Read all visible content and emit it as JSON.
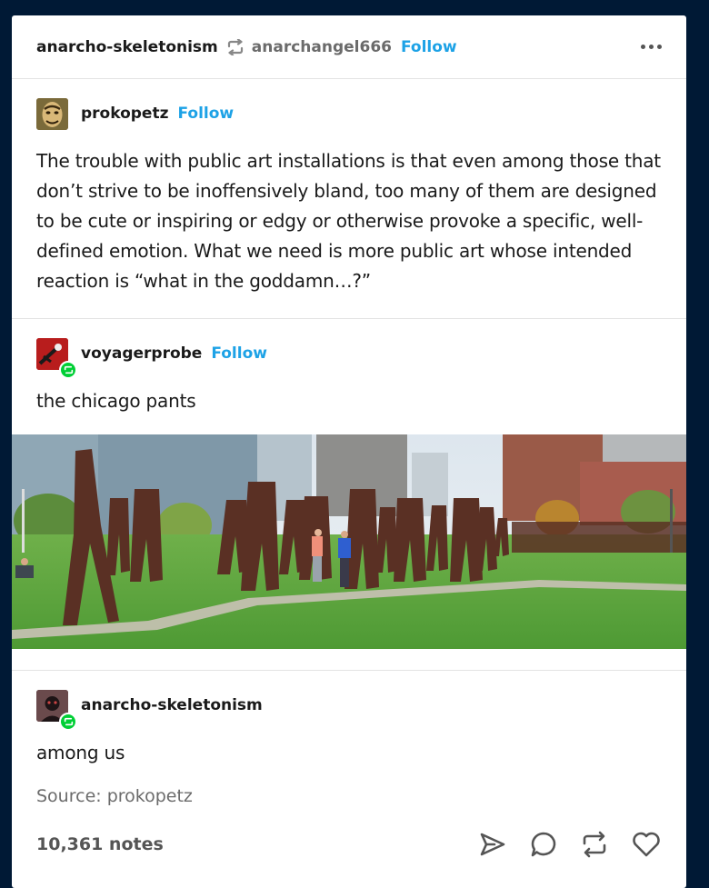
{
  "header": {
    "blog_name": "anarcho-skeletonism",
    "reblogged_from": "anarchangel666",
    "follow_label": "Follow"
  },
  "posts": [
    {
      "author": "prokopetz",
      "follow_label": "Follow",
      "text": "The trouble with public art installations is that even among those that don’t strive to be inoffensively bland, too many of them are designed to be cute or inspiring or edgy or otherwise provoke a specific, well-defined emotion. What we need is more public art whose intended reaction is “what in the goddamn…?”"
    },
    {
      "author": "voyagerprobe",
      "follow_label": "Follow",
      "text": "the chicago pants"
    },
    {
      "author": "anarcho-skeletonism",
      "text": "among us"
    }
  ],
  "footer": {
    "source": "Source: prokopetz",
    "notes": "10,361 notes"
  },
  "colors": {
    "background": "#001935",
    "accent": "#1da2e6",
    "reblog_badge": "#00cf35"
  },
  "icons": [
    "reblog-icon",
    "more-icon",
    "share-icon",
    "reply-icon",
    "reblog-icon",
    "like-icon"
  ]
}
